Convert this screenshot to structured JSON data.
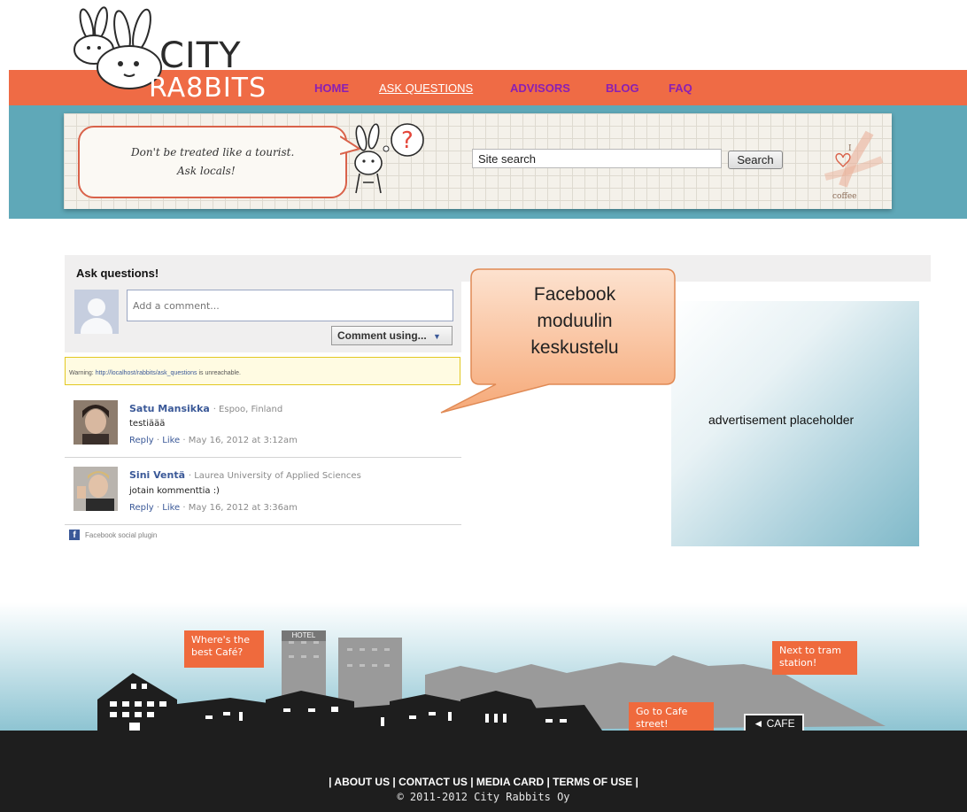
{
  "header": {
    "logo_line1": "CITY",
    "logo_line2": "RA8BITS",
    "nav": [
      {
        "label": "HOME"
      },
      {
        "label": "ASK QUESTIONS"
      },
      {
        "label": "ADVISORS"
      },
      {
        "label": "BLOG"
      },
      {
        "label": "FAQ"
      }
    ]
  },
  "banner": {
    "slogan_line1": "Don't be treated like a tourist.",
    "slogan_line2": "Ask locals!",
    "search_value": "Site search",
    "search_button": "Search",
    "coffee_label": "coffee",
    "coffee_i": "I"
  },
  "facebook_panel": {
    "title": "Ask questions!",
    "comment_placeholder": "Add a comment...",
    "comment_using": "Comment using...",
    "warning_label": "Warning:",
    "warning_url": "http://localhost/rabbits/ask_questions",
    "warning_suffix": "is unreachable.",
    "comments": [
      {
        "name": "Satu Mansikka",
        "meta": "· Espoo, Finland",
        "text": "testiäää",
        "reply": "Reply",
        "like": "Like",
        "date": "· May 16, 2012 at 3:12am"
      },
      {
        "name": "Sini Ventä",
        "meta": "· Laurea University of Applied Sciences",
        "text": "jotain kommenttia :)",
        "reply": "Reply",
        "like": "Like",
        "date": "· May 16, 2012 at 3:36am"
      }
    ],
    "social_plugin": "Facebook social plugin"
  },
  "callout": {
    "line1": "Facebook",
    "line2": "moduulin",
    "line3": "keskustelu"
  },
  "ad": {
    "text": "advertisement placeholder"
  },
  "footer": {
    "bubble_cafe": "Where's the best Café?",
    "hotel_sign": "HOTEL",
    "bubble_tram": "Next to tram station!",
    "bubble_street": "Go to Cafe street!",
    "cafe_sign": "◄ CAFE",
    "links": "| ABOUT US | CONTACT US | MEDIA CARD | TERMS OF USE |",
    "copyright": "© 2011-2012 City Rabbits Oy"
  },
  "colors": {
    "nav_orange": "#ef6b45",
    "nav_link_purple": "#8a1fb3",
    "banner_teal": "#5fa8b8",
    "facebook_blue": "#3b5998",
    "callout_orange": "#f8b88a"
  }
}
